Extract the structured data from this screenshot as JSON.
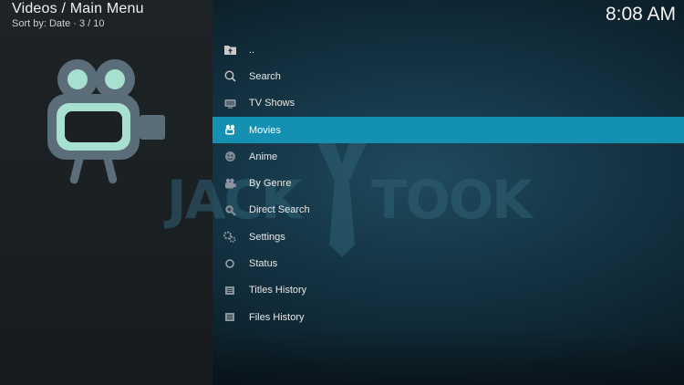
{
  "header": {
    "title": "Videos / Main Menu",
    "subtitle": "Sort by: Date  ·  3 / 10",
    "clock": "8:08 AM"
  },
  "watermark": {
    "left_text": "JACK",
    "right_text": "TOOK"
  },
  "menu": {
    "items": [
      {
        "label": "..",
        "icon": "folder-up-icon"
      },
      {
        "label": "Search",
        "icon": "search-icon"
      },
      {
        "label": "TV Shows",
        "icon": "tv-icon"
      },
      {
        "label": "Movies",
        "icon": "movie-icon",
        "selected": true
      },
      {
        "label": "Anime",
        "icon": "anime-icon"
      },
      {
        "label": "By Genre",
        "icon": "genre-icon"
      },
      {
        "label": "Direct Search",
        "icon": "direct-search-icon"
      },
      {
        "label": "Settings",
        "icon": "settings-icon"
      },
      {
        "label": "Status",
        "icon": "status-icon"
      },
      {
        "label": "Titles History",
        "icon": "titles-history-icon"
      },
      {
        "label": "Files History",
        "icon": "files-history-icon"
      }
    ]
  },
  "colors": {
    "selection": "#1490b3",
    "icon_body": "#5b6d79",
    "icon_accent": "#a8e0d0"
  }
}
